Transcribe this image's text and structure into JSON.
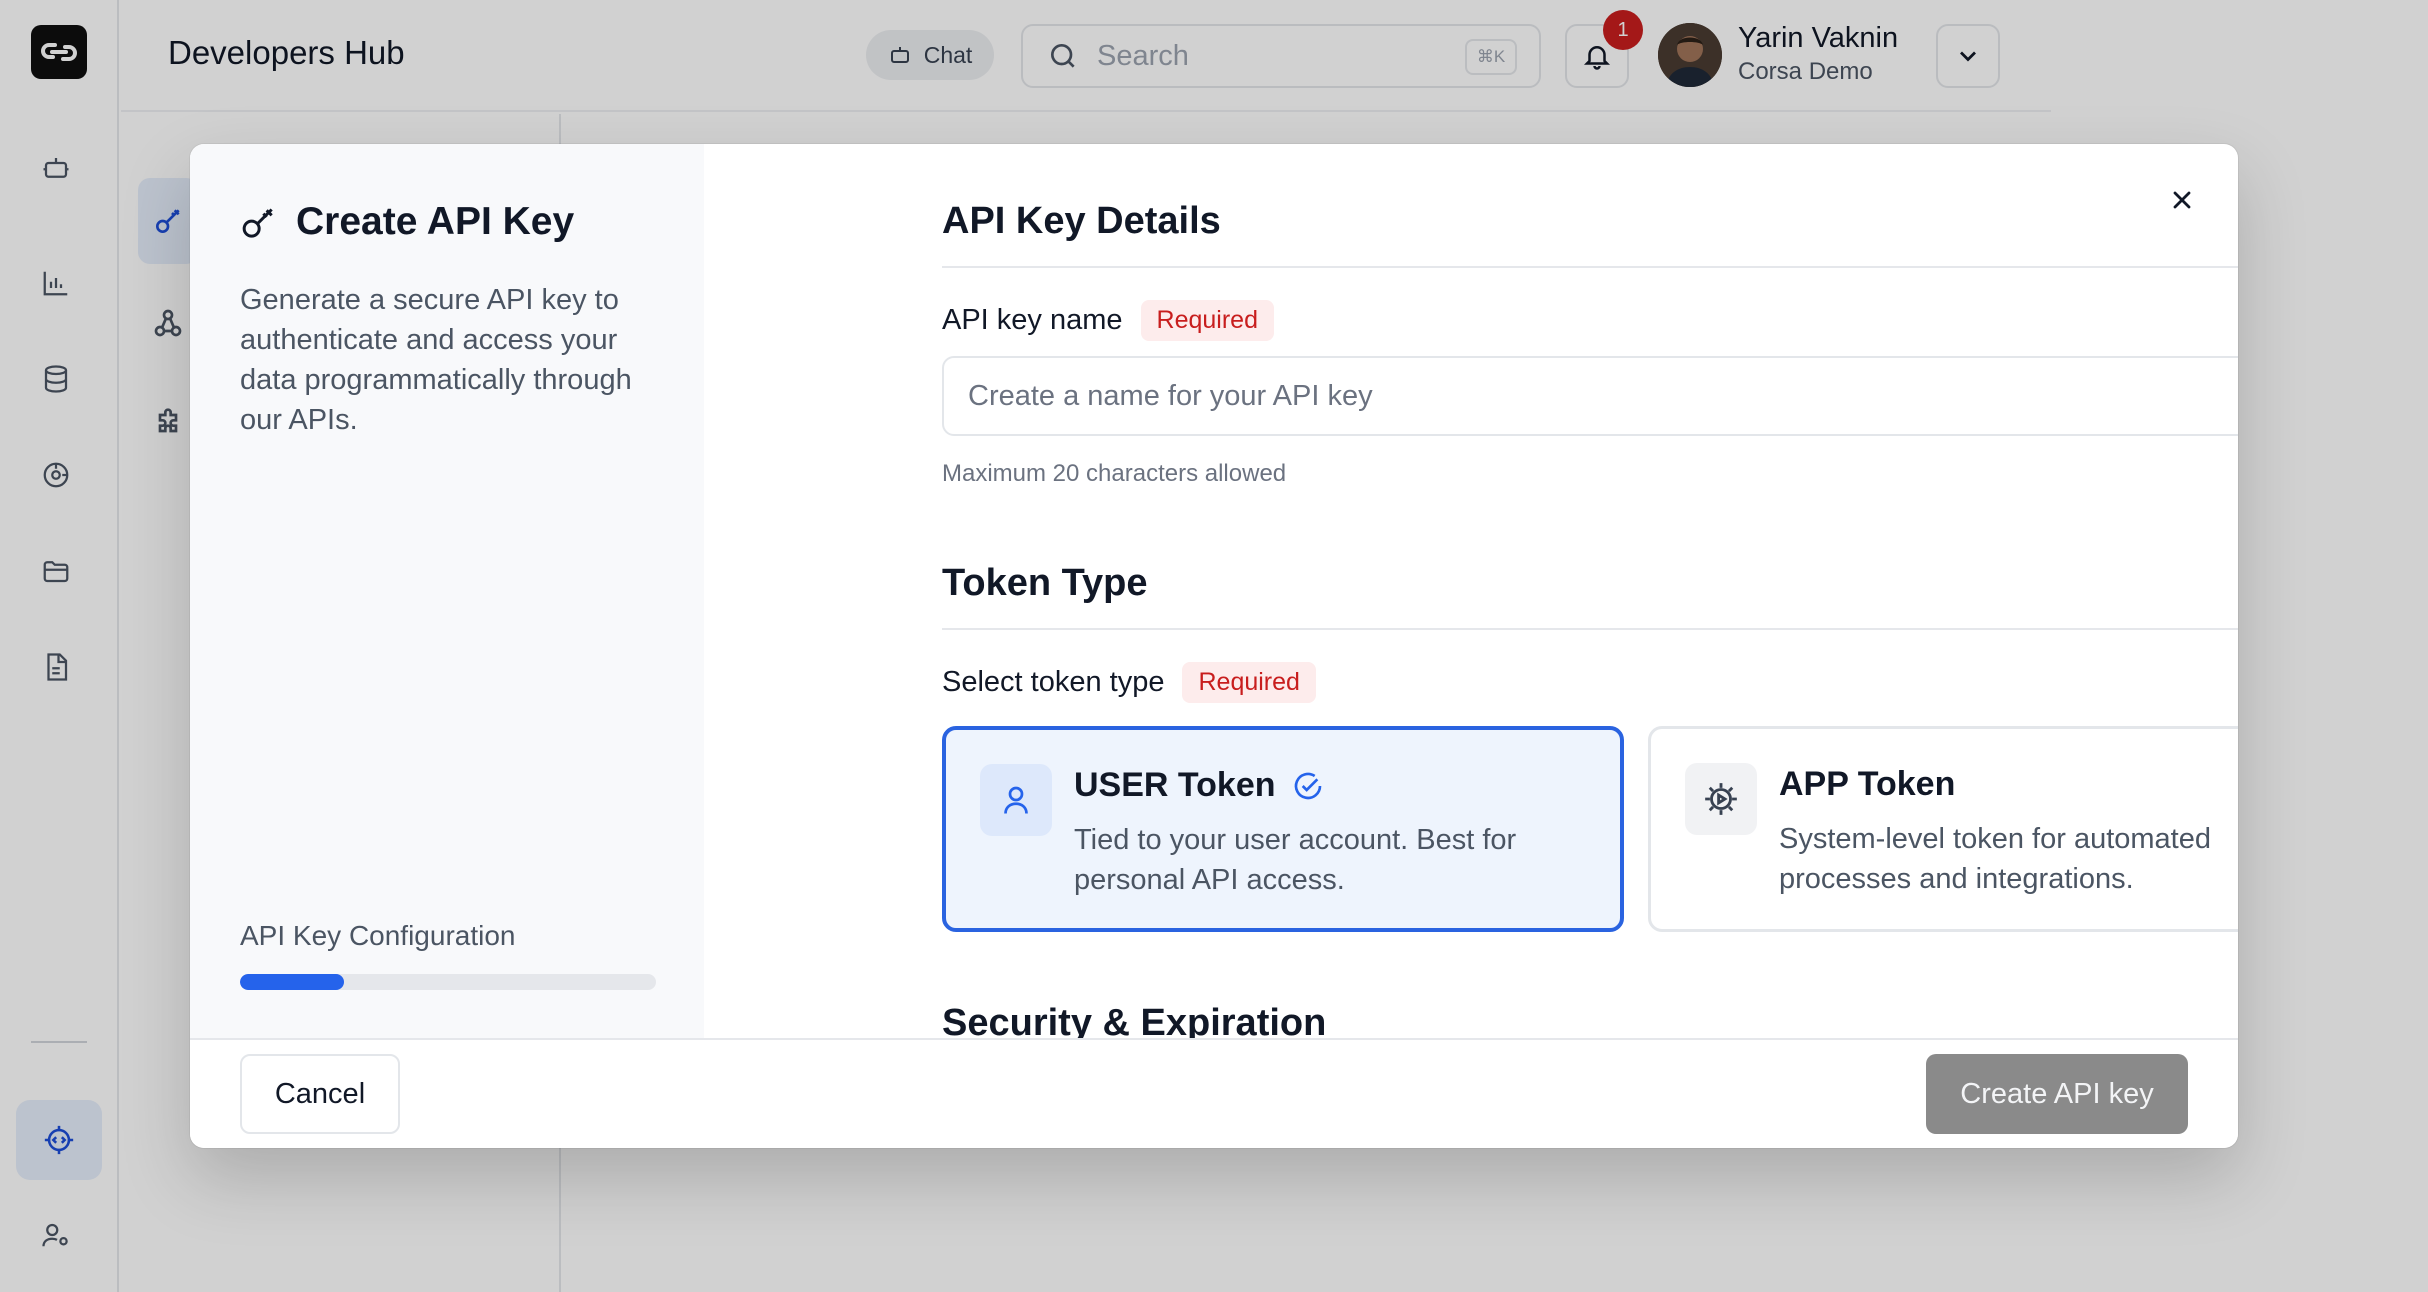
{
  "header": {
    "title": "Developers Hub",
    "chat_label": "Chat",
    "search_placeholder": "Search",
    "search_shortcut": "⌘K",
    "notification_count": "1",
    "user_name": "Yarin Vaknin",
    "user_org": "Corsa Demo"
  },
  "icons": {
    "logo": "link-logo-icon",
    "rail": [
      "bot-icon",
      "bar-chart-icon",
      "database-icon",
      "analytics-icon",
      "folder-icon",
      "document-icon",
      "developer-settings-icon",
      "user-settings-icon"
    ],
    "subnav": [
      "key-icon",
      "webhook-icon",
      "puzzle-icon"
    ]
  },
  "modal": {
    "title": "Create API Key",
    "description": "Generate a secure API key to authenticate and access your data programmatically through our APIs.",
    "progress_label": "API Key Configuration",
    "progress_percent": 25,
    "details_section_title": "API Key Details",
    "name_label": "API key name",
    "required_badge": "Required",
    "name_placeholder": "Create a name for your API key",
    "name_value": "",
    "name_hint": "Maximum 20 characters allowed",
    "token_section_title": "Token Type",
    "token_select_label": "Select token type",
    "tokens": [
      {
        "name": "USER Token",
        "description": "Tied to your user account. Best for personal API access.",
        "selected": true
      },
      {
        "name": "APP Token",
        "description": "System-level token for automated processes and integrations.",
        "selected": false
      }
    ],
    "security_section_title": "Security & Expiration",
    "cancel_label": "Cancel",
    "create_label": "Create API key"
  },
  "colors": {
    "accent": "#2563eb",
    "required_text": "#c81e1e",
    "disabled_button": "#8a8a8a"
  }
}
